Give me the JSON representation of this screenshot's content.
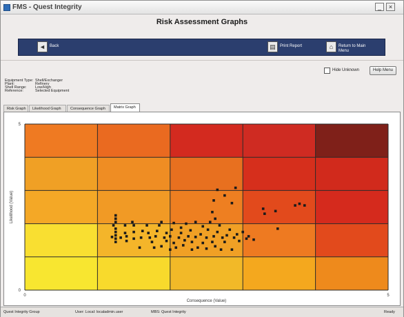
{
  "window": {
    "title": "FMS - Quest Integrity",
    "minimize_icon": "minimize-icon",
    "close_icon": "close-icon"
  },
  "header": {
    "title": "Risk Assessment Graphs"
  },
  "nav": {
    "back_label": "Back",
    "back_icon": "back-arrow-icon",
    "print_label": "Print Report",
    "print_icon": "print-icon",
    "return_label": "Return to Main Menu",
    "return_icon": "home-icon"
  },
  "options": {
    "checkbox_label": "Hide Unknown",
    "checkbox_checked": false,
    "help_label": "Help Menu"
  },
  "meta": [
    {
      "label": "Equipment Type:",
      "value": "Shell/Exchanger"
    },
    {
      "label": "Plant:",
      "value": "Refinery"
    },
    {
      "label": "Shell Range:",
      "value": "Low/High"
    },
    {
      "label": "Reference:",
      "value": "Selected Equipment"
    }
  ],
  "tabs": [
    {
      "label": "Risk Graph"
    },
    {
      "label": "Likelihood Graph"
    },
    {
      "label": "Consequence Graph"
    },
    {
      "label": "Matrix Graph",
      "active": true
    }
  ],
  "chart_data": {
    "type": "scatter",
    "xlabel": "Consequence (Value)",
    "ylabel": "Likelihood (Value)",
    "xlim": [
      0,
      5
    ],
    "ylim": [
      0,
      5
    ],
    "x_ticks": [
      "0",
      "",
      "",
      "",
      "",
      "5"
    ],
    "y_ticks": [
      "0",
      "",
      "",
      "",
      "",
      "5"
    ],
    "grid": true,
    "cell_colors": [
      [
        "#f8e630",
        "#f8da2c",
        "#f2b928",
        "#f4a81e",
        "#ee8a1c"
      ],
      [
        "#f9df31",
        "#f4b52a",
        "#f0a025",
        "#ee7a21",
        "#e24a1c"
      ],
      [
        "#f4a826",
        "#f19a25",
        "#ee7f21",
        "#e24a1c",
        "#d52a1d"
      ],
      [
        "#f0a025",
        "#ef8d23",
        "#e8701f",
        "#d62f1c",
        "#d12a1c"
      ],
      [
        "#ef7a22",
        "#ea6a20",
        "#d32a1f",
        "#cf2b22",
        "#7f2019"
      ]
    ],
    "marker_color": "#1a1a1a",
    "points": [
      [
        1.25,
        2.25
      ],
      [
        1.25,
        2.15
      ],
      [
        1.25,
        2.05
      ],
      [
        1.22,
        1.95
      ],
      [
        1.25,
        1.85
      ],
      [
        1.25,
        1.75
      ],
      [
        1.25,
        1.65
      ],
      [
        1.25,
        1.55
      ],
      [
        1.25,
        1.45
      ],
      [
        1.2,
        1.6
      ],
      [
        1.32,
        1.58
      ],
      [
        1.38,
        1.95
      ],
      [
        1.38,
        1.72
      ],
      [
        1.4,
        1.62
      ],
      [
        1.4,
        1.48
      ],
      [
        1.5,
        1.55
      ],
      [
        1.5,
        1.75
      ],
      [
        1.5,
        1.95
      ],
      [
        1.48,
        2.05
      ],
      [
        1.58,
        1.28
      ],
      [
        1.6,
        1.58
      ],
      [
        1.62,
        1.78
      ],
      [
        1.68,
        1.95
      ],
      [
        1.7,
        1.72
      ],
      [
        1.72,
        1.58
      ],
      [
        1.75,
        1.45
      ],
      [
        1.78,
        1.28
      ],
      [
        1.8,
        1.62
      ],
      [
        1.82,
        1.78
      ],
      [
        1.85,
        1.95
      ],
      [
        1.88,
        2.05
      ],
      [
        1.88,
        1.32
      ],
      [
        1.92,
        1.58
      ],
      [
        1.95,
        1.72
      ],
      [
        1.95,
        1.48
      ],
      [
        2.0,
        1.22
      ],
      [
        2.0,
        1.62
      ],
      [
        2.02,
        1.82
      ],
      [
        2.05,
        2.02
      ],
      [
        2.05,
        1.42
      ],
      [
        2.08,
        1.28
      ],
      [
        2.12,
        1.58
      ],
      [
        2.15,
        1.72
      ],
      [
        2.15,
        1.88
      ],
      [
        2.18,
        1.35
      ],
      [
        2.2,
        1.5
      ],
      [
        2.22,
        2.0
      ],
      [
        2.25,
        1.62
      ],
      [
        2.28,
        1.8
      ],
      [
        2.3,
        1.22
      ],
      [
        2.3,
        1.45
      ],
      [
        2.35,
        1.6
      ],
      [
        2.35,
        2.05
      ],
      [
        2.38,
        1.28
      ],
      [
        2.42,
        1.68
      ],
      [
        2.45,
        1.92
      ],
      [
        2.45,
        1.42
      ],
      [
        2.5,
        1.58
      ],
      [
        2.5,
        1.25
      ],
      [
        2.52,
        1.82
      ],
      [
        2.55,
        2.05
      ],
      [
        2.58,
        1.45
      ],
      [
        2.6,
        1.62
      ],
      [
        2.62,
        1.32
      ],
      [
        2.65,
        1.75
      ],
      [
        2.68,
        1.95
      ],
      [
        2.7,
        1.22
      ],
      [
        2.72,
        1.58
      ],
      [
        2.75,
        1.45
      ],
      [
        2.78,
        1.65
      ],
      [
        2.82,
        1.82
      ],
      [
        2.85,
        1.22
      ],
      [
        2.88,
        1.58
      ],
      [
        2.92,
        1.68
      ],
      [
        2.95,
        1.48
      ],
      [
        3.0,
        1.75
      ],
      [
        3.05,
        1.55
      ],
      [
        3.08,
        1.62
      ],
      [
        3.15,
        1.52
      ],
      [
        2.58,
        2.35
      ],
      [
        2.62,
        2.15
      ],
      [
        2.6,
        2.7
      ],
      [
        2.65,
        3.02
      ],
      [
        2.75,
        2.85
      ],
      [
        2.85,
        2.62
      ],
      [
        2.9,
        3.08
      ],
      [
        3.28,
        2.45
      ],
      [
        3.3,
        2.3
      ],
      [
        3.45,
        2.38
      ],
      [
        3.48,
        1.85
      ],
      [
        3.72,
        2.55
      ],
      [
        3.78,
        2.6
      ],
      [
        3.85,
        2.55
      ]
    ]
  },
  "status": {
    "company": "Quest Integrity Group",
    "user": "User: Local: localadmin.user",
    "app": "MBS: Quest Integrity",
    "right": "Ready"
  }
}
